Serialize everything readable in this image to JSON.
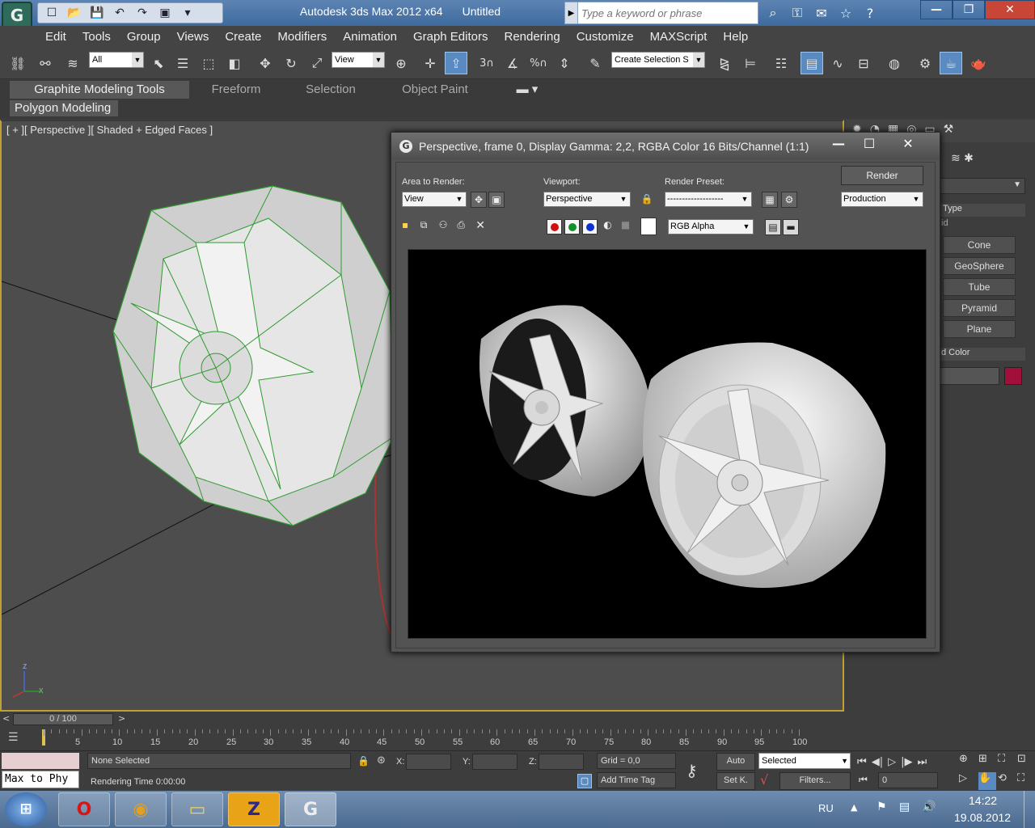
{
  "titlebar": {
    "app_title": "Autodesk 3ds Max  2012 x64",
    "doc_title": "Untitled",
    "search_placeholder": "Type a keyword or phrase"
  },
  "menu": [
    "Edit",
    "Tools",
    "Group",
    "Views",
    "Create",
    "Modifiers",
    "Animation",
    "Graph Editors",
    "Rendering",
    "Customize",
    "MAXScript",
    "Help"
  ],
  "toolbar": {
    "selection_filter": "All",
    "ref_coord": "View",
    "snap_label": "3",
    "angle_snap": "%",
    "named_selection": "Create Selection S"
  },
  "ribbon": {
    "tabs": [
      "Graphite Modeling Tools",
      "Freeform",
      "Selection",
      "Object Paint"
    ],
    "panel_label": "Polygon Modeling"
  },
  "viewport": {
    "label": "[ + ][ Perspective ][ Shaded + Edged Faces ]",
    "axis_z": "z",
    "axis_x": "x"
  },
  "command_panel": {
    "rollout_type": "Type",
    "rollout_type_sub": "id",
    "buttons": [
      "Cone",
      "GeoSphere",
      "Tube",
      "Pyramid",
      "Plane"
    ],
    "color_rollout": "d Color",
    "object_color": "#a0103a"
  },
  "render_window": {
    "title": "Perspective, frame 0, Display Gamma: 2,2, RGBA Color 16 Bits/Channel (1:1)",
    "area_label": "Area to Render:",
    "area_value": "View",
    "viewport_label": "Viewport:",
    "viewport_value": "Perspective",
    "preset_label": "Render Preset:",
    "preset_value": "-------------------",
    "render_button": "Render",
    "production_value": "Production",
    "channel_value": "RGB Alpha"
  },
  "timeline": {
    "slider_label": "0 / 100",
    "ticks": [
      "5",
      "10",
      "15",
      "20",
      "25",
      "30",
      "35",
      "40",
      "45",
      "50",
      "55",
      "60",
      "65",
      "70",
      "75",
      "80",
      "85",
      "90",
      "95",
      "100"
    ]
  },
  "status": {
    "selection_text": "None Selected",
    "maxscript_text": "Max to Phy",
    "render_time": "Rendering Time  0:00:00",
    "x_label": "X:",
    "y_label": "Y:",
    "z_label": "Z:",
    "grid": "Grid = 0,0",
    "add_time_tag": "Add Time Tag",
    "auto": "Auto",
    "set_key": "Set K.",
    "key_filter": "Selected",
    "filters": "Filters...",
    "frame_value": "0"
  },
  "taskbar": {
    "lang": "RU",
    "time": "14:22",
    "date": "19.08.2012",
    "apps": [
      "windows-start",
      "opera",
      "chrome",
      "explorer",
      "zbrush",
      "3dsmax"
    ]
  }
}
